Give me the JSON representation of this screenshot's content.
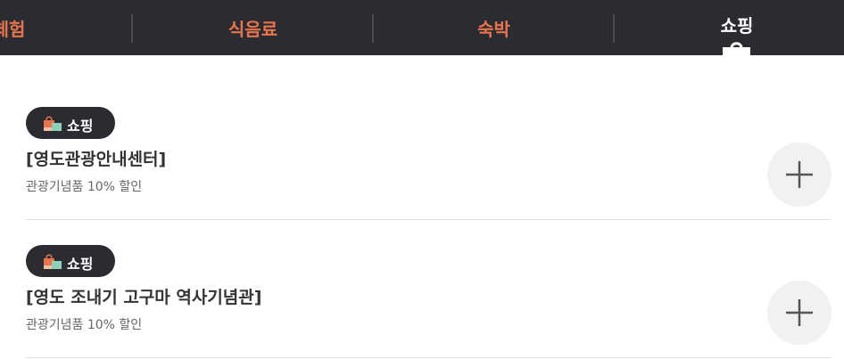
{
  "nav": {
    "tabs": [
      {
        "label": "체험"
      },
      {
        "label": "식음료"
      },
      {
        "label": "숙박"
      },
      {
        "label": "쇼핑"
      }
    ],
    "active_tab": "쇼핑",
    "tab_color": "#e8744d",
    "active_color": "#ffffff",
    "background": "#2b2c31"
  },
  "list": {
    "items": [
      {
        "badge": {
          "icon": "shopping-bag-icon",
          "label": "쇼핑"
        },
        "title": "[영도관광안내센터]",
        "description": "관광기념품 10% 할인",
        "action_icon": "plus-icon"
      },
      {
        "badge": {
          "icon": "shopping-bag-icon",
          "label": "쇼핑"
        },
        "title": "[영도 조내기 고구마 역사기념관]",
        "description": "관광기념품 10% 할인",
        "action_icon": "plus-icon"
      }
    ]
  }
}
